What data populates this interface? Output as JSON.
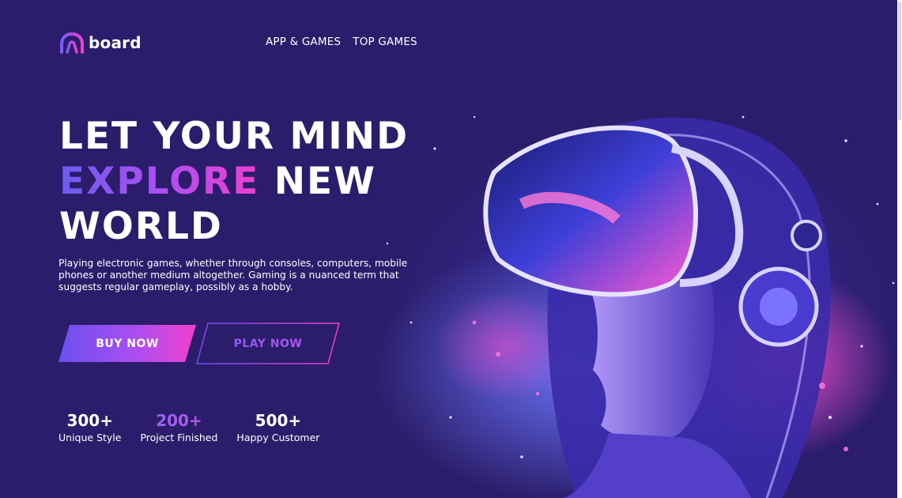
{
  "brand": {
    "name": "board"
  },
  "nav": {
    "items": [
      "APP & GAMES",
      "TOP GAMES"
    ]
  },
  "hero": {
    "headline_line1": "LET YOUR MIND",
    "headline_accent": "EXPLORE",
    "headline_line2_rest": " NEW",
    "headline_line3": "WORLD",
    "description": "Playing electronic games, whether through consoles, computers, mobile phones or another medium altogether. Gaming is a nuanced term that suggests regular gameplay, possibly as a hobby.",
    "buy_label": "BUY NOW",
    "play_label": "PLAY NOW"
  },
  "stats": [
    {
      "value": "300+",
      "label": "Unique Style"
    },
    {
      "value": "200+",
      "label": "Project Finished"
    },
    {
      "value": "500+",
      "label": "Happy Customer"
    }
  ],
  "colors": {
    "background": "#2b1d6b",
    "accent_purple": "#6b4ff0",
    "accent_pink": "#f03fcf"
  },
  "icons": {
    "logo": "arch-logo-icon"
  }
}
